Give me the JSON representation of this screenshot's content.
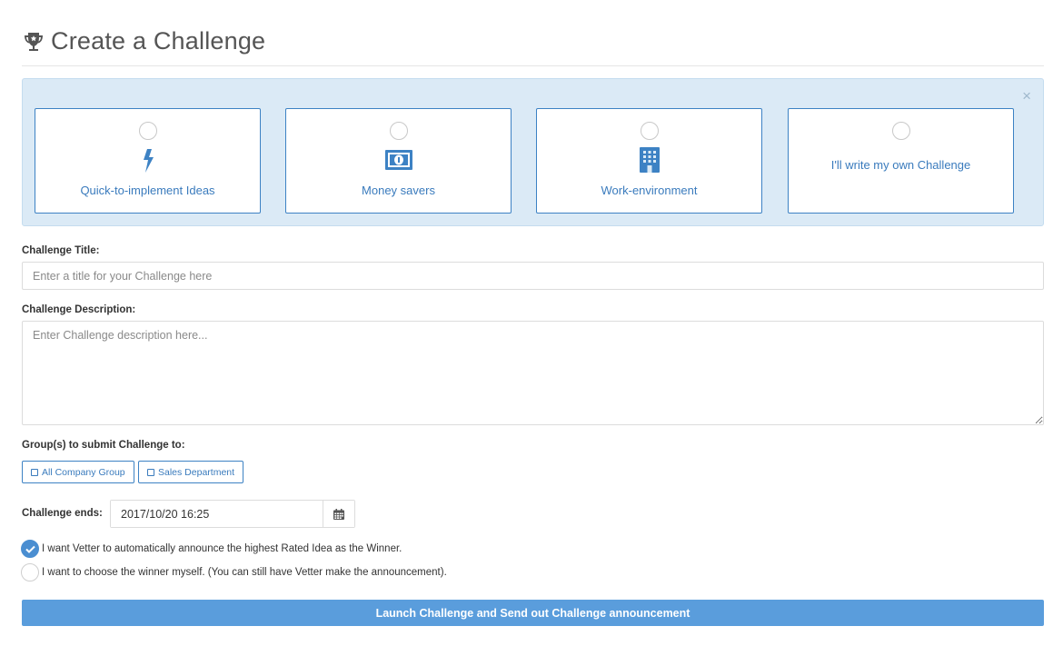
{
  "header": {
    "title": "Create a Challenge",
    "icon": "trophy-icon"
  },
  "suggestions": {
    "close_symbol": "×",
    "cards": [
      {
        "label": "Quick-to-implement Ideas",
        "icon": "lightning-icon"
      },
      {
        "label": "Money savers",
        "icon": "money-icon"
      },
      {
        "label": "Work-environment",
        "icon": "building-icon"
      },
      {
        "label": "I'll write my own Challenge",
        "icon": ""
      }
    ]
  },
  "form": {
    "title_label": "Challenge Title:",
    "title_placeholder": "Enter a title for your Challenge here",
    "title_value": "",
    "description_label": "Challenge Description:",
    "description_placeholder": "Enter Challenge description here...",
    "description_value": "",
    "groups_label": "Group(s) to submit Challenge to:",
    "groups": [
      {
        "label": "All Company Group",
        "checked": false
      },
      {
        "label": "Sales Department",
        "checked": false
      }
    ],
    "ends_label": "Challenge ends:",
    "ends_value": "2017/10/20 16:25",
    "winner_options": [
      {
        "label": "I want Vetter to automatically announce the highest Rated Idea as the Winner.",
        "checked": true
      },
      {
        "label": "I want to choose the winner myself. (You can still have Vetter make the announcement).",
        "checked": false
      }
    ],
    "submit_label": "Launch Challenge and Send out Challenge announcement"
  },
  "colors": {
    "accent": "#3d82c4",
    "panel_bg": "#dbeaf6",
    "button": "#5a9ddc"
  }
}
